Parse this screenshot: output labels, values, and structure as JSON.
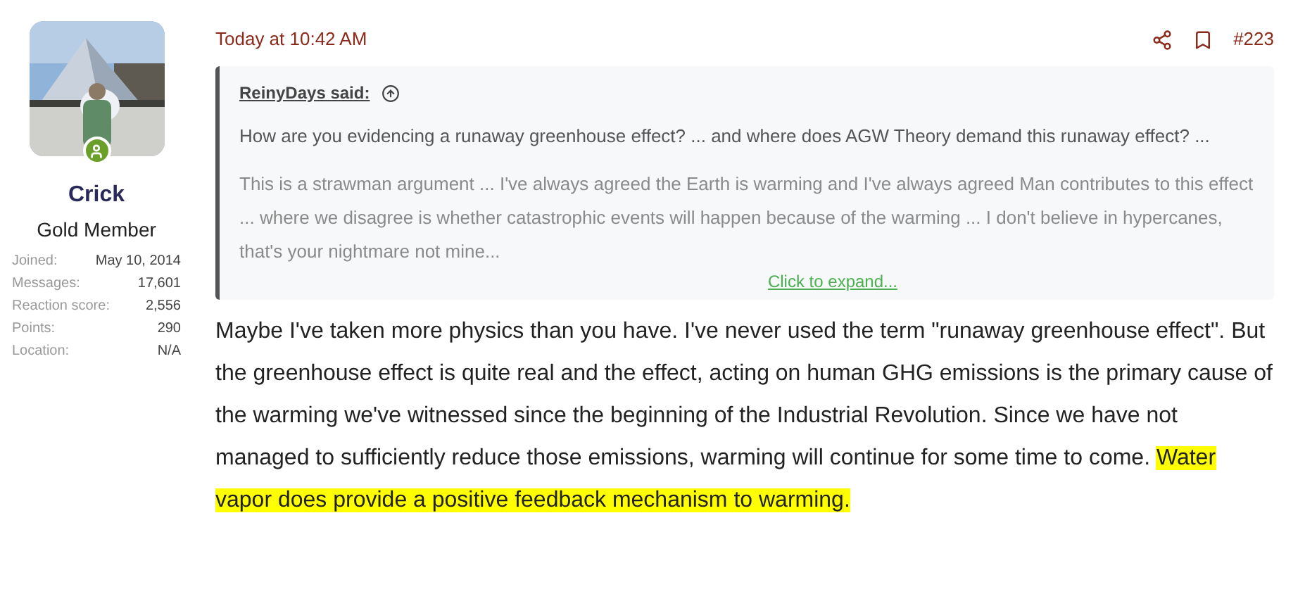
{
  "author": {
    "name": "Crick",
    "title": "Gold Member",
    "online": true,
    "kind": "picture",
    "stats": [
      {
        "label": "Joined:",
        "value": "May 10, 2014"
      },
      {
        "label": "Messages:",
        "value": "17,601"
      },
      {
        "label": "Reaction score:",
        "value": "2,556"
      },
      {
        "label": "Points:",
        "value": "290"
      },
      {
        "label": "Location:",
        "value": "N/A"
      }
    ]
  },
  "post": {
    "time": "Today at 10:42 AM",
    "number": "#223",
    "quote": {
      "author": "ReinyDays said:",
      "paragraphs": [
        "How are you evidencing a runaway greenhouse effect? ... and where does AGW Theory demand this runaway effect? ...",
        "This is a strawman argument ... I've always agreed the Earth is warming and I've always agreed Man contributes to this effect ... where we disagree is whether catastrophic events will happen because of the warming ... I don't believe in hypercanes, that's your nightmare not mine..."
      ],
      "expand": "Click to expand..."
    },
    "body": [
      {
        "text": "Maybe I've taken more physics than you have. I've never used the term \"runaway greenhouse effect\". But the greenhouse effect is quite real and the effect, acting on human GHG emissions is the primary cause of the warming we've witnessed since the beginning of the Industrial Revolution. Since we have not managed to sufficiently reduce those emissions, warming will continue for some time to come. ",
        "highlighted": false
      },
      {
        "text": "Water vapor does provide a positive feedback mechanism to warming.",
        "highlighted": true
      }
    ]
  }
}
